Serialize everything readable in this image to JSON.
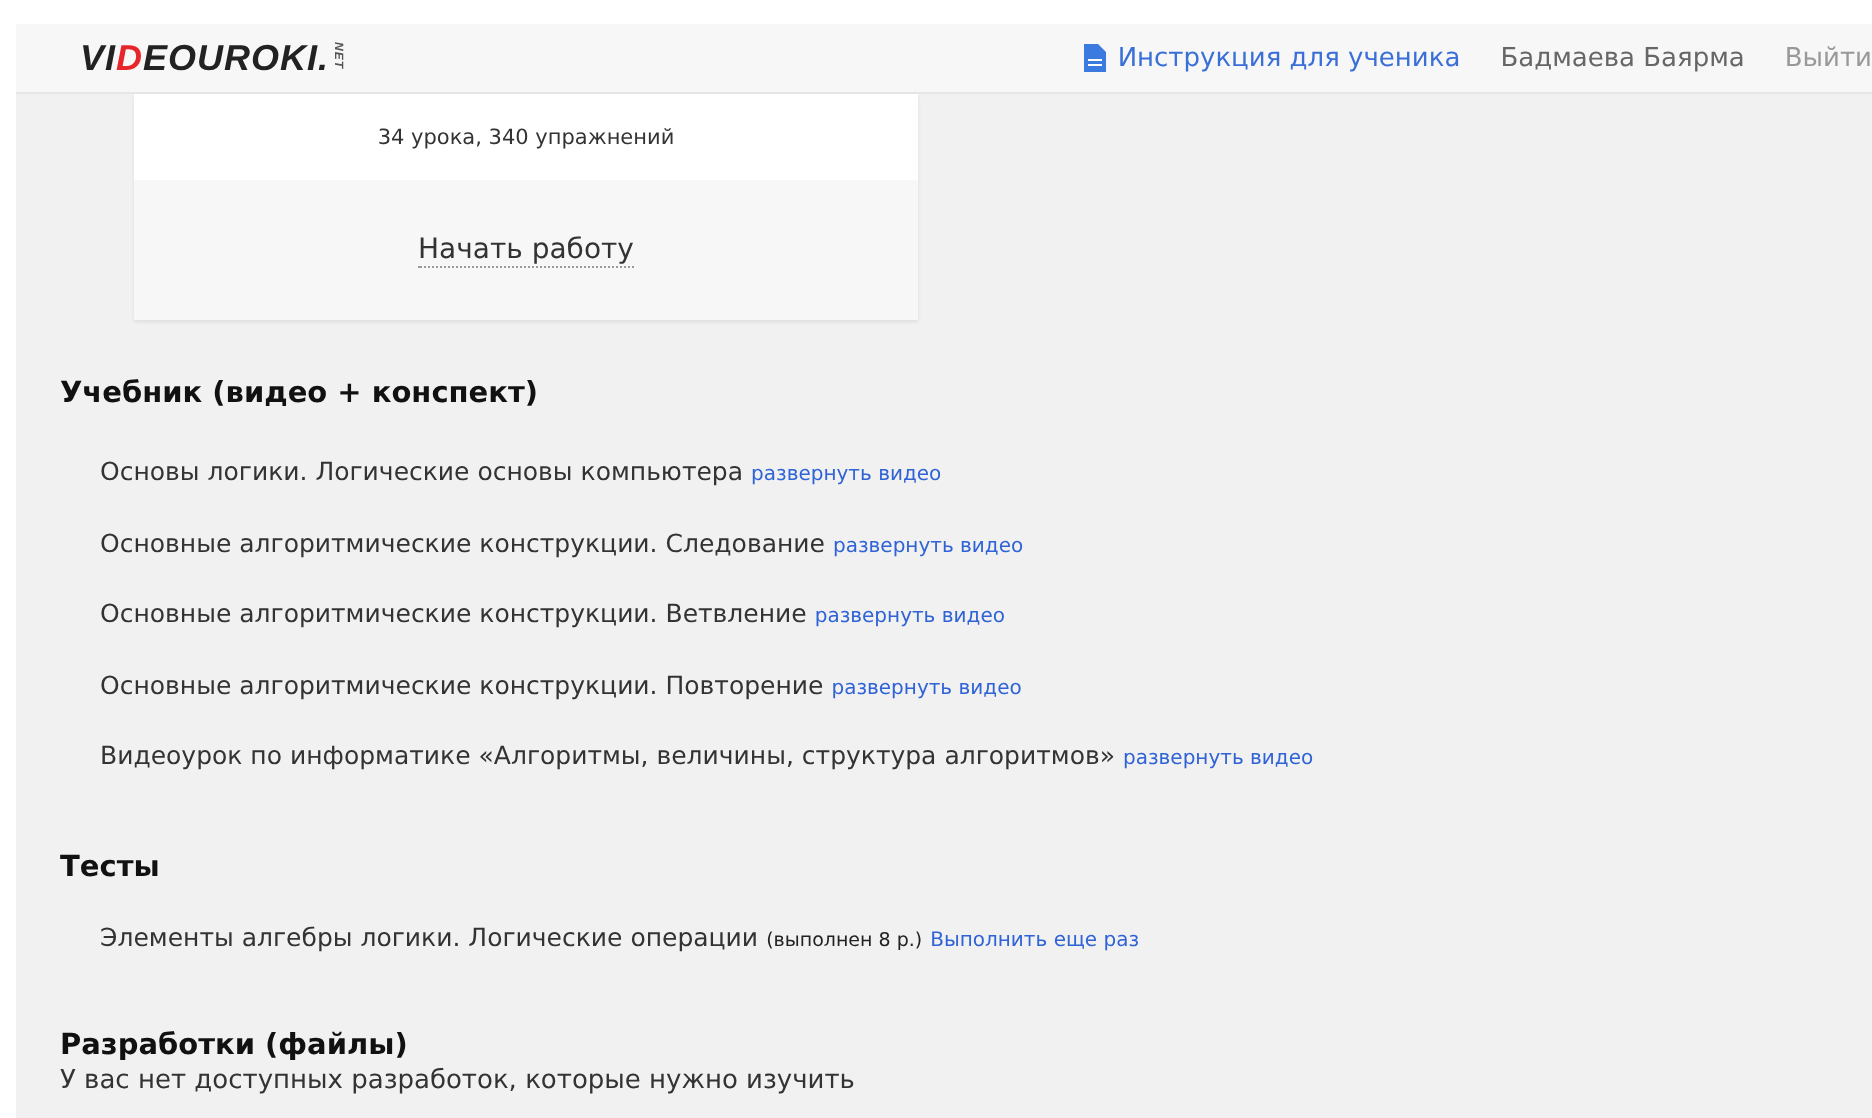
{
  "header": {
    "logo": {
      "before": "VI",
      "accent": "D",
      "after": "EOUROKI.",
      "suffix": "NET"
    },
    "instruction_link": "Инструкция для ученика",
    "user_name": "Бадмаева Баярма",
    "logout": "Выйти"
  },
  "course_card": {
    "summary": "34 урока, 340 упражнений",
    "start_button": "Начать работу"
  },
  "textbook": {
    "title": "Учебник (видео + конспект)",
    "items": [
      {
        "title": "Основы логики. Логические основы компьютера",
        "link": "развернуть видео"
      },
      {
        "title": "Основные алгоритмические конструкции. Следование",
        "link": "развернуть видео"
      },
      {
        "title": "Основные алгоритмические конструкции. Ветвление",
        "link": "развернуть видео"
      },
      {
        "title": "Основные алгоритмические конструкции. Повторение",
        "link": "развернуть видео"
      },
      {
        "title": "Видеоурок по информатике «Алгоритмы, величины, структура алгоритмов»",
        "link": "развернуть видео"
      }
    ]
  },
  "tests": {
    "title": "Тесты",
    "items": [
      {
        "title": "Элементы алгебры логики. Логические операции",
        "note": "(выполнен 8 р.)",
        "link": "Выполнить еще раз"
      }
    ]
  },
  "materials": {
    "title": "Разработки (файлы)",
    "message": "У вас нет доступных разработок, которые нужно изучить"
  }
}
